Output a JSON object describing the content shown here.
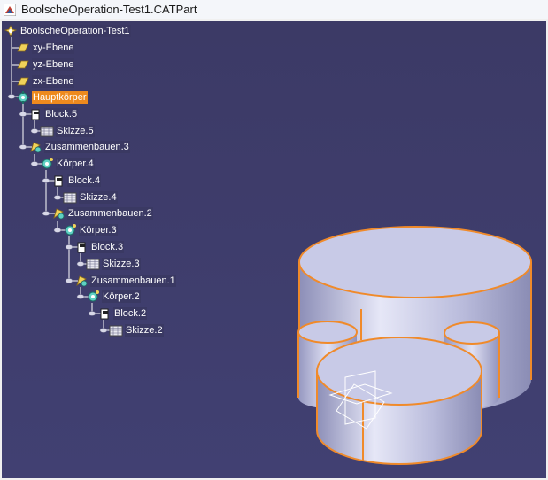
{
  "window": {
    "title": "BoolscheOperation-Test1.CATPart",
    "icon": "catpart-file-icon"
  },
  "tree": {
    "root": "BoolscheOperation-Test1",
    "planes": [
      "xy-Ebene",
      "yz-Ebene",
      "zx-Ebene"
    ],
    "hauptkoerper": "Hauptkörper",
    "block5": "Block.5",
    "skizze5": "Skizze.5",
    "zusammenbauen3": "Zusammenbauen.3",
    "koerper4": "Körper.4",
    "block4": "Block.4",
    "skizze4": "Skizze.4",
    "zusammenbauen2": "Zusammenbauen.2",
    "koerper3": "Körper.3",
    "block3": "Block.3",
    "skizze3": "Skizze.3",
    "zusammenbauen1": "Zusammenbauen.1",
    "koerper2": "Körper.2",
    "block2": "Block.2",
    "skizze2": "Skizze.2"
  },
  "colors": {
    "background": "#3e3c6c",
    "selection": "#ee8a1e",
    "edge_highlight": "#f08a2a",
    "body_face": "#c6c8e6"
  }
}
